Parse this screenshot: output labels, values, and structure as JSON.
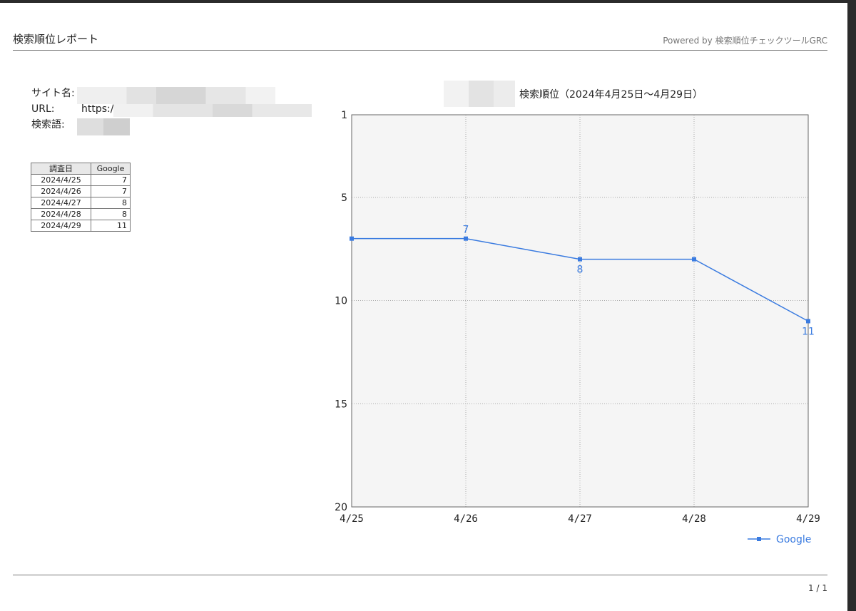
{
  "header": {
    "title": "検索順位レポート",
    "powered_by": "Powered by 検索順位チェックツールGRC"
  },
  "info": {
    "site_label": "サイト名:",
    "url_label": "URL:",
    "url_value": "https:/",
    "keyword_label": "検索語:"
  },
  "table": {
    "headers": [
      "調査日",
      "Google"
    ],
    "rows": [
      [
        "2024/4/25",
        "7"
      ],
      [
        "2024/4/26",
        "7"
      ],
      [
        "2024/4/27",
        "8"
      ],
      [
        "2024/4/28",
        "8"
      ],
      [
        "2024/4/29",
        "11"
      ]
    ]
  },
  "chart_data": {
    "type": "line",
    "title": "検索順位（2024年4月25日〜4月29日）",
    "categories": [
      "4/25",
      "4/26",
      "4/27",
      "4/28",
      "4/29"
    ],
    "series": [
      {
        "name": "Google",
        "values": [
          7,
          7,
          8,
          8,
          11
        ],
        "color": "#3a7be0"
      }
    ],
    "data_labels": [
      {
        "index": 1,
        "text": "7"
      },
      {
        "index": 2,
        "text": "8"
      },
      {
        "index": 4,
        "text": "11"
      }
    ],
    "y_ticks": [
      1,
      5,
      10,
      15,
      20
    ],
    "ylim": [
      1,
      20
    ],
    "y_inverted": true,
    "grid": true,
    "legend": "bottom-right",
    "plot_background": "#f5f5f5"
  },
  "footer": {
    "page": "1 / 1"
  }
}
